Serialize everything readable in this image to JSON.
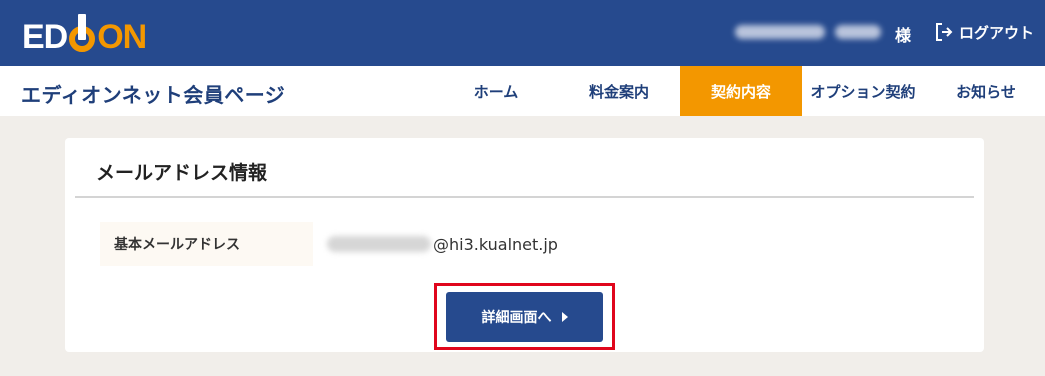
{
  "header": {
    "logo_text_left": "ED",
    "logo_text_right": "ON",
    "honorific": "様",
    "logout_label": "ログアウト"
  },
  "nav": {
    "site_title": "エディオンネット会員ページ",
    "items": [
      {
        "label": "ホーム",
        "active": false
      },
      {
        "label": "料金案内",
        "active": false
      },
      {
        "label": "契約内容",
        "active": true
      },
      {
        "label": "オプション契約",
        "active": false
      },
      {
        "label": "お知らせ",
        "active": false
      }
    ]
  },
  "card": {
    "title": "メールアドレス情報",
    "row_label": "基本メールアドレス",
    "email_domain": "@hi3.kualnet.jp",
    "button_label": "詳細画面へ"
  },
  "colors": {
    "header_bg": "#264a8e",
    "accent_orange": "#f39700",
    "highlight_red": "#e0061c"
  }
}
